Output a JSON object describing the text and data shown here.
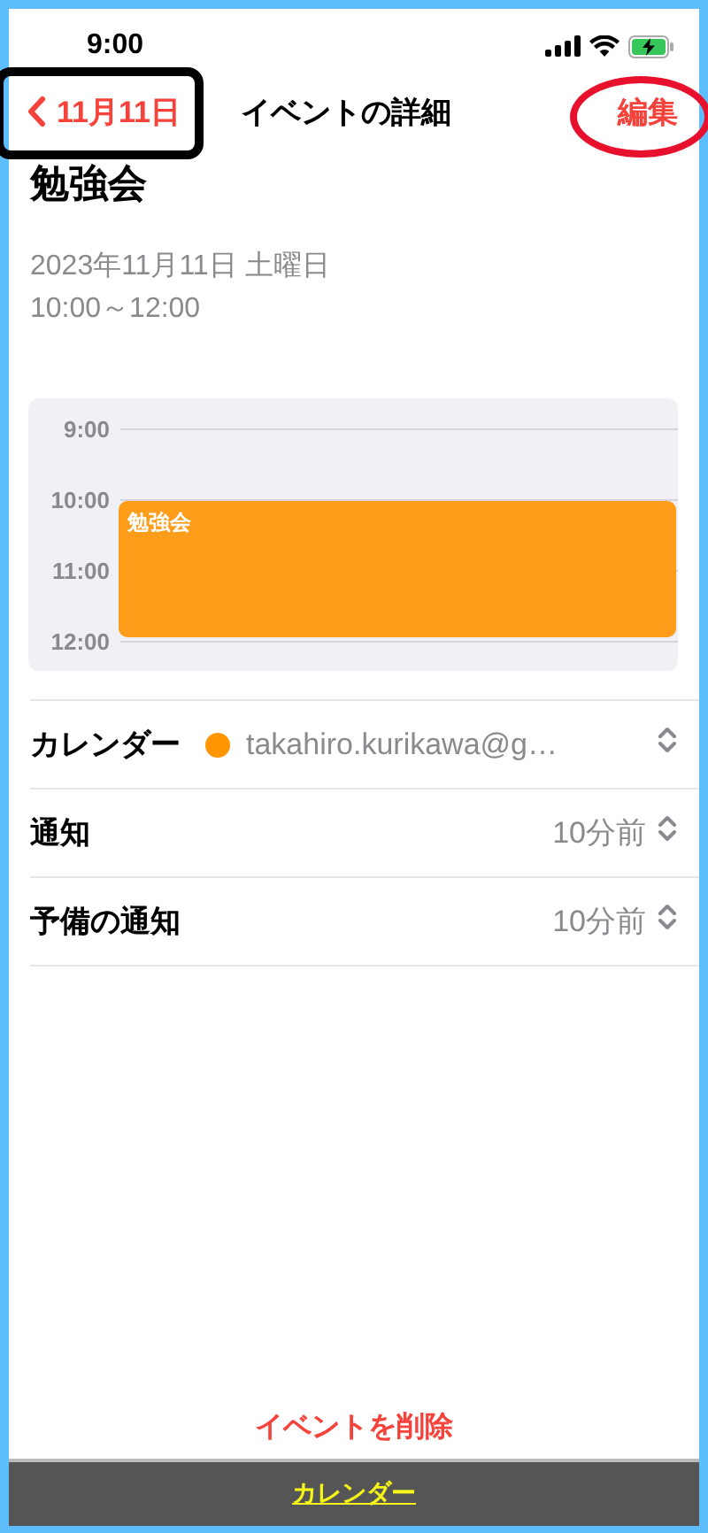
{
  "status_bar": {
    "time": "9:00"
  },
  "nav": {
    "back": "11月11日",
    "title": "イベントの詳細",
    "edit": "編集"
  },
  "event": {
    "title": "勉強会",
    "date": "2023年11月11日 土曜日",
    "time": "10:00～12:00"
  },
  "timeline": {
    "hours": [
      "9:00",
      "10:00",
      "11:00",
      "12:00"
    ],
    "events": [
      {
        "title": "勉強会"
      }
    ]
  },
  "rows": [
    {
      "kind": "calendar",
      "label": "カレンダー",
      "value": "takahiro.kurikawa@g…",
      "color": "#ff9500"
    },
    {
      "kind": "select",
      "label": "通知",
      "value": "10分前"
    },
    {
      "kind": "select",
      "label": "予備の通知",
      "value": "10分前"
    }
  ],
  "delete_button": "イベントを削除",
  "bottom_bar": {
    "link": "カレンダー"
  }
}
